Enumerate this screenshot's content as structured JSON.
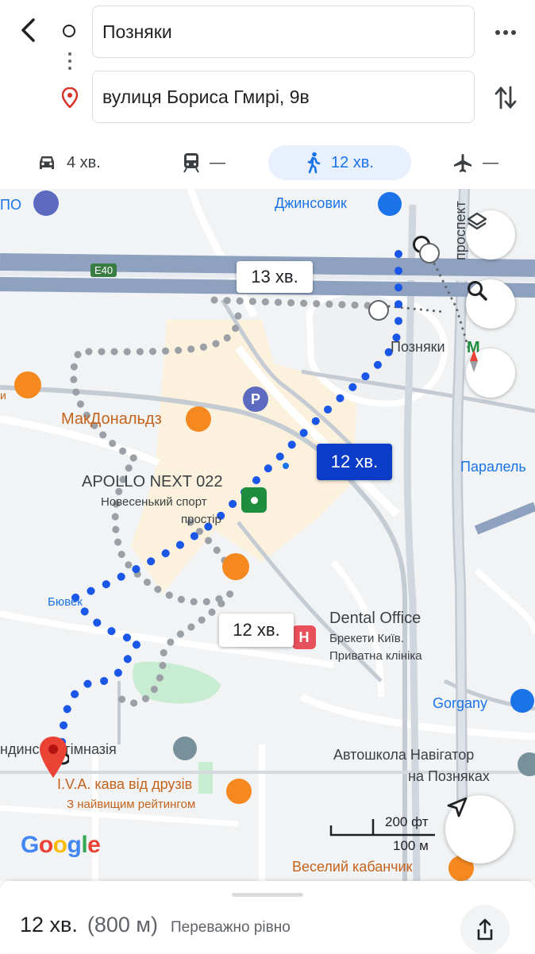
{
  "header": {
    "origin_value": "Позняки",
    "destination_value": "вулиця Бориса Гмирі, 9в",
    "modes": [
      {
        "icon": "car-icon",
        "label": "4 хв."
      },
      {
        "icon": "transit-icon",
        "label": "—"
      },
      {
        "icon": "walk-icon",
        "label": "12 хв.",
        "selected": true
      },
      {
        "icon": "flight-icon",
        "label": "—"
      }
    ]
  },
  "map": {
    "labels": {
      "po_partial": "ПО",
      "dzhynsovyk": "Джинсовик",
      "highway": "E40",
      "prospekt": "проспект",
      "pozniaky": "Позняки",
      "mcdonalds": "МакДональдз",
      "apollo": "APOLLO NEXT 022",
      "apollo_sub1": "Новесенький спорт",
      "apollo_sub2": "простір",
      "bjuvek": "Бювек",
      "dental": "Dental Office",
      "dental_sub1": "Брекети Київ.",
      "dental_sub2": "Приватна клініка",
      "paralel": "Паралель",
      "gorgany": "Gorgany",
      "gymnasium": "ндинська гімназія",
      "autoschool1": "Автошкола Навігатор",
      "autoschool2": "на Позняках",
      "iva": "I.V.A. кава від друзів",
      "iva_sub": "З найвищим рейтингом",
      "veselyi": "Веселий кабанчик",
      "left_edge_letter": "и"
    },
    "time_labels": {
      "top": "13 хв.",
      "selected": "12 хв.",
      "bottom": "12 хв."
    },
    "scale": {
      "feet": "200 фт",
      "meters": "100 м"
    },
    "google_logo": "Google",
    "colors": {
      "route": "#1a56e8",
      "alt_route": "#9aa0a6",
      "highway": "#8fa3c0",
      "selected_badge": "#0b3cc7"
    }
  },
  "summary": {
    "time": "12 хв.",
    "distance": "(800 м)",
    "terrain": "Переважно рівно"
  }
}
